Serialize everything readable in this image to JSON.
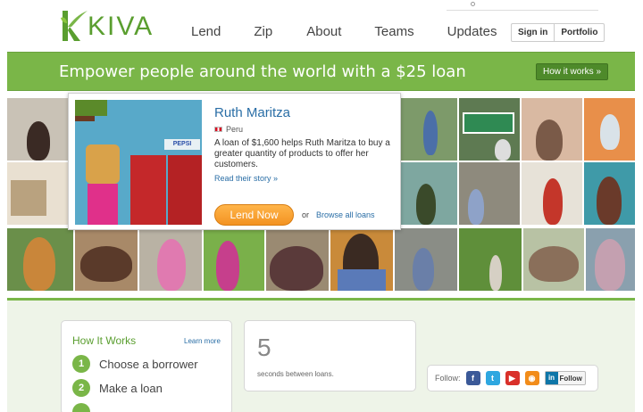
{
  "brand": {
    "name": "KIVA",
    "color": "#5a9e2f"
  },
  "nav": {
    "items": [
      "Lend",
      "Zip",
      "About",
      "Teams",
      "Updates"
    ],
    "sign_in": "Sign in",
    "portfolio": "Portfolio"
  },
  "banner": {
    "text": "Empower people around the world with a $25 loan",
    "how_it_works": "How it works »",
    "color": "#7ab648"
  },
  "featured": {
    "name": "Ruth Maritza",
    "country": "Peru",
    "description": "A loan of $1,600 helps Ruth Maritza to buy a greater quantity of products to offer her customers.",
    "read_story": "Read their story »",
    "lend_button": "Lend Now",
    "or": "or",
    "browse": "Browse all loans",
    "photo_text": "PEPSI"
  },
  "how_it_works": {
    "title": "How It Works",
    "learn_more": "Learn more",
    "steps": [
      "Choose a borrower",
      "Make a loan",
      ""
    ]
  },
  "timer": {
    "value": "5",
    "label": "seconds between loans."
  },
  "follow": {
    "label": "Follow:",
    "icons": [
      "facebook-icon",
      "twitter-icon",
      "youtube-icon",
      "rss-icon"
    ],
    "linkedin_label": "Follow"
  }
}
